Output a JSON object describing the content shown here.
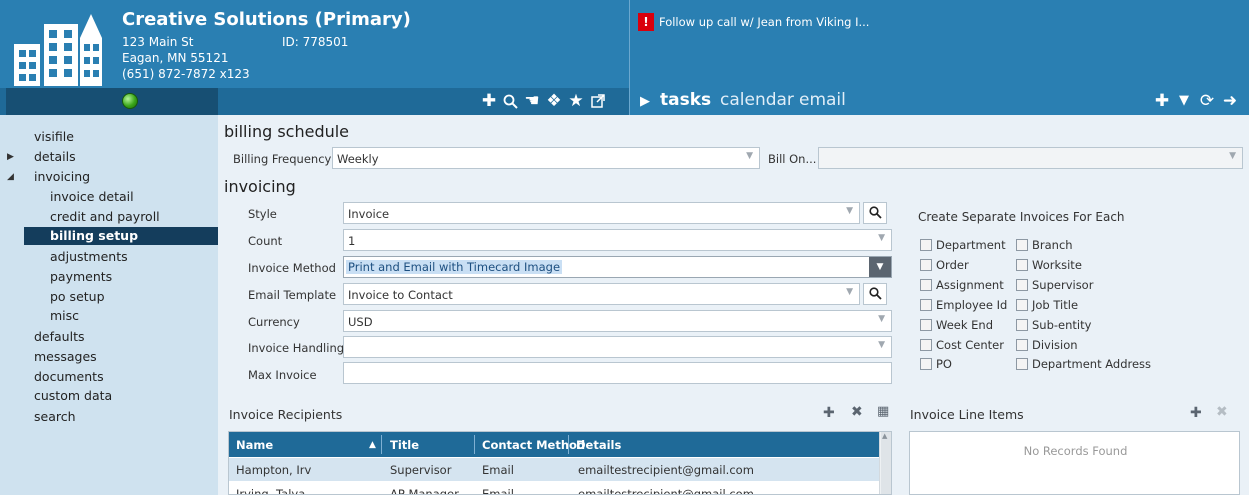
{
  "header": {
    "company_name": "Creative Solutions (Primary)",
    "address_line1": "123 Main St",
    "address_line2": "Eagan, MN  55121",
    "phone": "(651) 872-7872 x123",
    "id_label": "ID: 778501",
    "alert_badge": "!",
    "alert_text": "Follow up call w/ Jean from Viking I...",
    "tabs": {
      "play": "▶",
      "tasks": "tasks",
      "calendar": "calendar",
      "email": "email"
    },
    "icons": [
      "add-icon",
      "search-icon",
      "pointer-icon",
      "puzzle-icon",
      "star-icon",
      "external-link-icon",
      "filter-icon",
      "refresh-icon",
      "arrow-right-icon"
    ]
  },
  "sidebar": {
    "items": [
      {
        "label": "visifile"
      },
      {
        "label": "details"
      },
      {
        "label": "invoicing"
      },
      {
        "label": "invoice detail"
      },
      {
        "label": "credit and payroll"
      },
      {
        "label": "billing setup"
      },
      {
        "label": "adjustments"
      },
      {
        "label": "payments"
      },
      {
        "label": "po setup"
      },
      {
        "label": "misc"
      },
      {
        "label": "defaults"
      },
      {
        "label": "messages"
      },
      {
        "label": "documents"
      },
      {
        "label": "custom data"
      },
      {
        "label": "search"
      }
    ],
    "active_item": "billing setup"
  },
  "billing_schedule": {
    "title": "billing schedule",
    "frequency_label": "Billing Frequency",
    "frequency_value": "Weekly",
    "bill_on_label": "Bill On...",
    "bill_on_value": ""
  },
  "invoicing": {
    "title": "invoicing",
    "style_label": "Style",
    "style_value": "Invoice",
    "count_label": "Count",
    "count_value": "1",
    "method_label": "Invoice Method",
    "method_value": "Print and Email with Timecard Image",
    "template_label": "Email Template",
    "template_value": "Invoice to Contact",
    "currency_label": "Currency",
    "currency_value": "USD",
    "handling_label": "Invoice Handling",
    "handling_value": "",
    "max_label": "Max Invoice",
    "max_value": ""
  },
  "separate": {
    "title": "Create Separate Invoices For Each",
    "left": [
      "Department",
      "Order",
      "Assignment",
      "Employee Id",
      "Week End",
      "Cost Center",
      "PO"
    ],
    "right": [
      "Branch",
      "Worksite",
      "Supervisor",
      "Job Title",
      "Sub-entity",
      "Division",
      "Department Address"
    ]
  },
  "recipients": {
    "title": "Invoice Recipients",
    "columns": [
      "Name",
      "Title",
      "Contact Method",
      "Details"
    ],
    "sort_indicator": "▲",
    "rows": [
      [
        "Hampton, Irv",
        "Supervisor",
        "Email",
        "emailtestrecipient@gmail.com"
      ],
      [
        "Irving, Talya",
        "AP Manager",
        "Email",
        "emailtestrecipient@gmail.com"
      ]
    ]
  },
  "line_items": {
    "title": "Invoice Line Items",
    "empty_text": "No Records Found"
  },
  "colors": {
    "header_blue": "#2a7fb2",
    "sidebar_bg": "#cfe2ef",
    "active_nav": "#143d5c",
    "grid_header": "#1f6a98",
    "alert_red": "#d9000d"
  }
}
